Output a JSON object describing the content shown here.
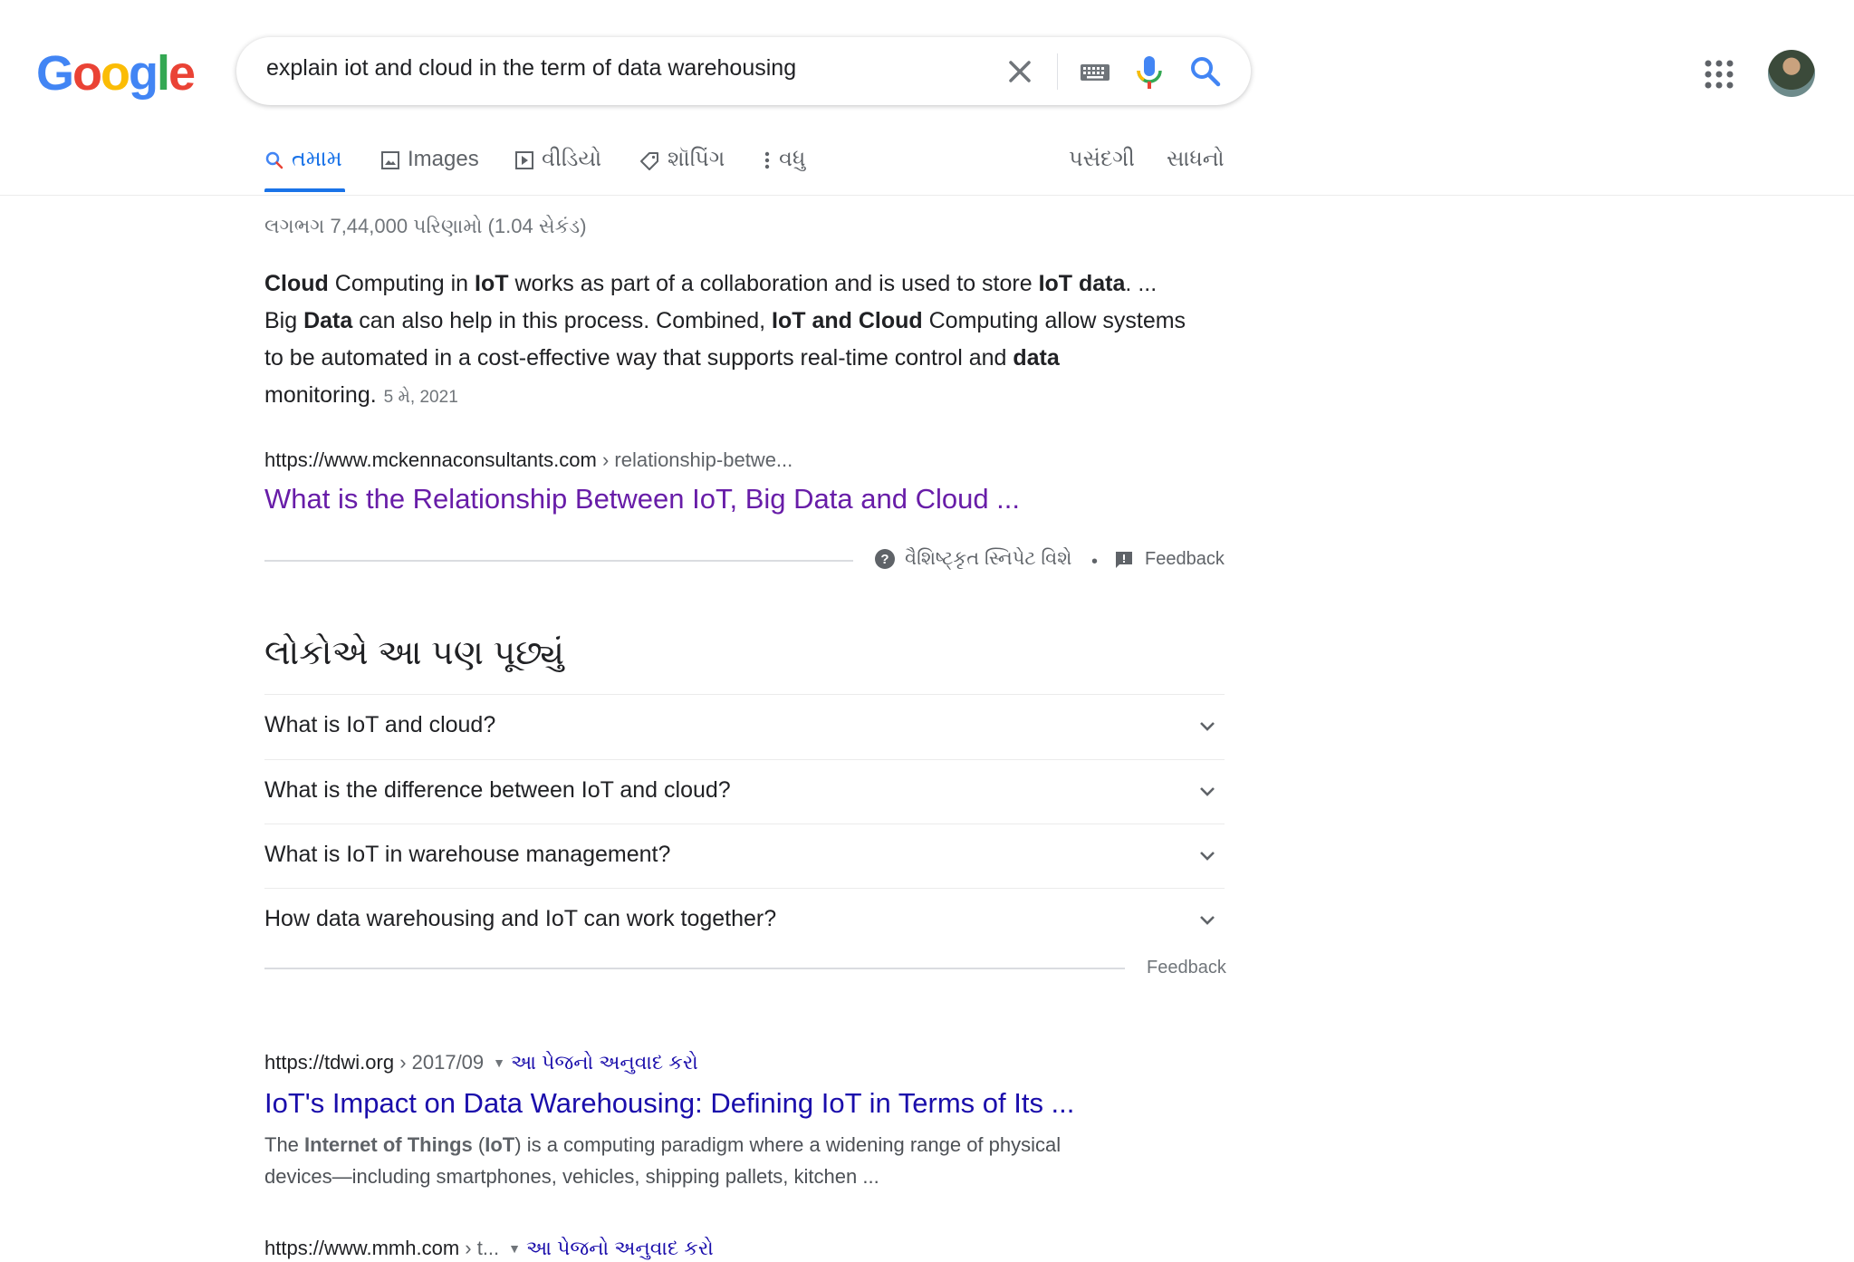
{
  "header": {
    "logo_letters": [
      {
        "ch": "G",
        "color": "#4285f4"
      },
      {
        "ch": "o",
        "color": "#ea4335"
      },
      {
        "ch": "o",
        "color": "#fbbc05"
      },
      {
        "ch": "g",
        "color": "#4285f4"
      },
      {
        "ch": "l",
        "color": "#34a853"
      },
      {
        "ch": "e",
        "color": "#ea4335"
      }
    ],
    "search_query": "explain iot and cloud in the term of data warehousing",
    "icons": [
      "close-icon",
      "keyboard-icon",
      "mic-icon",
      "search-icon",
      "apps-grid-icon",
      "avatar"
    ]
  },
  "tabs": {
    "all": "તમામ",
    "images": "Images",
    "videos": "વીડિયો",
    "shopping": "શૉપિંગ",
    "more": "વધુ",
    "preferences": "પસંદગી",
    "tools": "સાધનો"
  },
  "stats": "લગભગ 7,44,000 પરિણામો (1.04 સેકંડ)",
  "featured_snippet": {
    "line1": [
      {
        "t": "Cloud",
        "b": true
      },
      {
        "t": " Computing in ",
        "b": false
      },
      {
        "t": "IoT",
        "b": true
      },
      {
        "t": " works as part of a collaboration and is used to store ",
        "b": false
      },
      {
        "t": "IoT data",
        "b": true
      },
      {
        "t": ". ...",
        "b": false
      }
    ],
    "line2": [
      {
        "t": "Big ",
        "b": false
      },
      {
        "t": "Data",
        "b": true
      },
      {
        "t": " can also help in this process. Combined, ",
        "b": false
      },
      {
        "t": "IoT and Cloud",
        "b": true
      },
      {
        "t": " Computing allow systems",
        "b": false
      }
    ],
    "line3": [
      {
        "t": "to be automated in a cost-effective way that supports real-time control and ",
        "b": false
      },
      {
        "t": "data",
        "b": true
      }
    ],
    "line4": [
      {
        "t": "monitoring.",
        "b": false
      }
    ],
    "date": "5 મે, 2021",
    "cite_domain": "https://www.mckennaconsultants.com",
    "cite_path": " › relationship-betwe...",
    "title": "What is the Relationship Between IoT, Big Data and Cloud ...",
    "about_label": "વૈશિષ્ટ્કૃત સ્નિપેટ વિશે",
    "dot": "•",
    "feedback": "Feedback"
  },
  "people_also_ask": {
    "title": "લોકોએ આ પણ પૂછ્યું",
    "questions": [
      "What is IoT and cloud?",
      "What is the difference between IoT and cloud?",
      "What is IoT in warehouse management?",
      "How data warehousing and IoT can work together?"
    ],
    "feedback": "Feedback"
  },
  "results": [
    {
      "cite_domain": "https://tdwi.org",
      "cite_path": " › 2017/09",
      "translate": "આ પેજનો અનુવાદ કરો",
      "title": "IoT's Impact on Data Warehousing: Defining IoT in Terms of Its ...",
      "desc_line1": [
        {
          "t": "The ",
          "b": false
        },
        {
          "t": "Internet of Things",
          "b": true
        },
        {
          "t": " (",
          "b": false
        },
        {
          "t": "IoT",
          "b": true
        },
        {
          "t": ") is a computing paradigm where a widening range of physical",
          "b": false
        }
      ],
      "desc_line2": "devices—including smartphones, vehicles, shipping pallets, kitchen ..."
    },
    {
      "cite_domain": "https://www.mmh.com",
      "cite_path": " › t...",
      "translate": "આ પેજનો અનુવાદ કરો"
    }
  ]
}
